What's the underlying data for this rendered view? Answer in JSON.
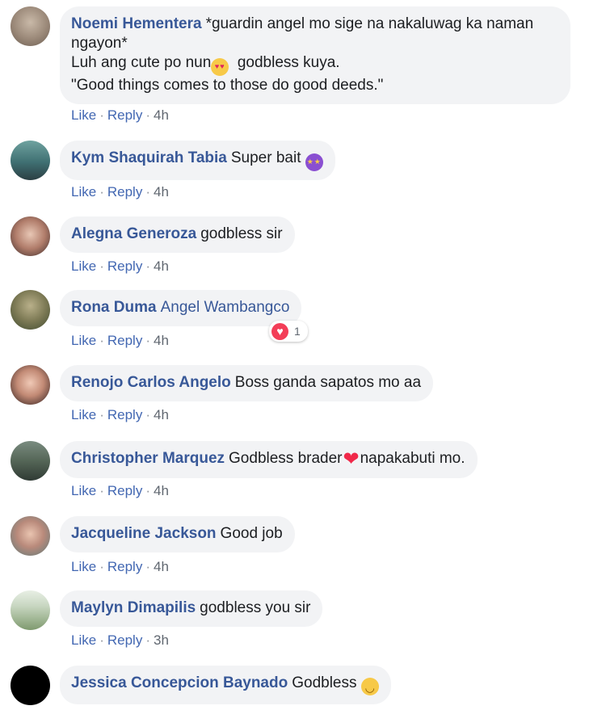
{
  "colors": {
    "author": "#385898",
    "link": "#4267b2",
    "bubble": "#f2f3f5",
    "meta": "#606770",
    "love": "#f33e58"
  },
  "action_labels": {
    "like": "Like",
    "reply": "Reply",
    "separator": "·"
  },
  "comments": [
    {
      "author": "Noemi Hementera",
      "lines": [
        "*guardin angel mo sige na nakaluwag ka naman ngayon*",
        "Luh ang cute po nun",
        "godbless kuya.",
        "\"Good things comes to those do good deeds.\""
      ],
      "emoji": "smiling-face-with-heart-eyes",
      "time": "4h"
    },
    {
      "author": "Kym Shaquirah Tabia",
      "text": "Super bait",
      "emoji": "star-struck",
      "time": "4h"
    },
    {
      "author": "Alegna Generoza",
      "text": "godbless sir",
      "time": "4h"
    },
    {
      "author": "Rona Duma",
      "mention": "Angel Wambangco",
      "time": "4h",
      "reaction": {
        "icon": "love-reaction",
        "count": "1"
      }
    },
    {
      "author": "Renojo Carlos Angelo",
      "text": "Boss ganda sapatos mo aa",
      "time": "4h"
    },
    {
      "author": "Christopher Marquez",
      "text_before": "Godbless brader",
      "text_after": "napakabuti mo.",
      "emoji": "red-heart",
      "time": "4h"
    },
    {
      "author": "Jacqueline Jackson",
      "text": "Good job",
      "time": "4h"
    },
    {
      "author": "Maylyn Dimapilis",
      "text": "godbless you sir",
      "time": "3h"
    },
    {
      "author": "Jessica Concepcion Baynado",
      "text": "Godbless",
      "emoji": "smiling-face",
      "time": ""
    }
  ]
}
